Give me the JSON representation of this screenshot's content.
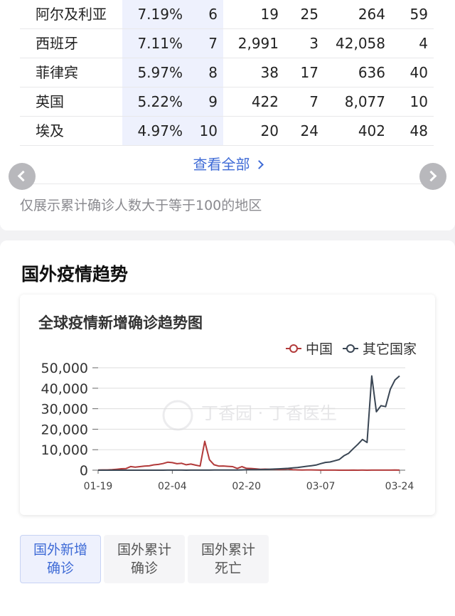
{
  "table": {
    "rows": [
      {
        "name": "阿尔及利亚",
        "pct": "7.19%",
        "rank": "6",
        "a": "19",
        "b": "25",
        "c": "264",
        "d": "59"
      },
      {
        "name": "西班牙",
        "pct": "7.11%",
        "rank": "7",
        "a": "2,991",
        "b": "3",
        "c": "42,058",
        "d": "4"
      },
      {
        "name": "菲律宾",
        "pct": "5.97%",
        "rank": "8",
        "a": "38",
        "b": "17",
        "c": "636",
        "d": "40"
      },
      {
        "name": "英国",
        "pct": "5.22%",
        "rank": "9",
        "a": "422",
        "b": "7",
        "c": "8,077",
        "d": "10"
      },
      {
        "name": "埃及",
        "pct": "4.97%",
        "rank": "10",
        "a": "20",
        "b": "24",
        "c": "402",
        "d": "48"
      }
    ],
    "see_all": "查看全部",
    "note": "仅展示累计确诊人数大于等于100的地区"
  },
  "trend": {
    "section_title": "国外疫情趋势",
    "watermark": "丁香园 · 丁香医生",
    "tabs": [
      {
        "label": "国外新增确诊",
        "active": true
      },
      {
        "label": "国外累计确诊",
        "active": false
      },
      {
        "label": "国外累计死亡",
        "active": false
      }
    ]
  },
  "chart_data": {
    "type": "line",
    "title": "全球疫情新增确诊趋势图",
    "xlabel": "",
    "ylabel": "",
    "ylim": [
      0,
      50000
    ],
    "yticks": [
      "50,000",
      "40,000",
      "30,000",
      "20,000",
      "10,000",
      "0"
    ],
    "xticks": [
      "01-19",
      "02-04",
      "02-20",
      "03-07",
      "03-24"
    ],
    "x": [
      "01-19",
      "01-20",
      "01-21",
      "01-22",
      "01-23",
      "01-24",
      "01-25",
      "01-26",
      "01-27",
      "01-28",
      "01-29",
      "01-30",
      "01-31",
      "02-01",
      "02-02",
      "02-03",
      "02-04",
      "02-05",
      "02-06",
      "02-07",
      "02-08",
      "02-09",
      "02-10",
      "02-11",
      "02-12",
      "02-13",
      "02-14",
      "02-15",
      "02-16",
      "02-17",
      "02-18",
      "02-19",
      "02-20",
      "02-21",
      "02-22",
      "02-23",
      "02-24",
      "02-25",
      "02-26",
      "02-27",
      "02-28",
      "02-29",
      "03-01",
      "03-02",
      "03-03",
      "03-04",
      "03-05",
      "03-06",
      "03-07",
      "03-08",
      "03-09",
      "03-10",
      "03-11",
      "03-12",
      "03-13",
      "03-14",
      "03-15",
      "03-16",
      "03-17",
      "03-18",
      "03-19",
      "03-20",
      "03-21",
      "03-22",
      "03-23",
      "03-24"
    ],
    "series": [
      {
        "name": "中国",
        "color": "#b23a3a",
        "values": [
          77,
          149,
          131,
          259,
          444,
          688,
          769,
          1771,
          1459,
          1737,
          1982,
          2102,
          2590,
          2829,
          3235,
          3887,
          3694,
          3143,
          3385,
          2652,
          2973,
          2467,
          2015,
          14108,
          5090,
          2641,
          2009,
          2048,
          1886,
          1749,
          820,
          1749,
          891,
          826,
          648,
          409,
          508,
          406,
          433,
          327,
          427,
          573,
          202,
          125,
          119,
          139,
          143,
          99,
          44,
          40,
          19,
          24,
          15,
          8,
          11,
          20,
          16,
          21,
          13,
          34,
          39,
          41,
          46,
          39,
          78,
          47
        ]
      },
      {
        "name": "其它国家",
        "color": "#3a4654",
        "values": [
          0,
          0,
          0,
          0,
          1,
          2,
          3,
          3,
          5,
          2,
          5,
          8,
          10,
          10,
          15,
          20,
          25,
          22,
          18,
          15,
          20,
          25,
          30,
          40,
          45,
          55,
          60,
          70,
          80,
          90,
          110,
          150,
          200,
          230,
          250,
          300,
          350,
          450,
          550,
          650,
          750,
          900,
          1100,
          1300,
          1600,
          1900,
          2200,
          2500,
          3200,
          3800,
          4000,
          4600,
          5200,
          7000,
          8200,
          10500,
          12600,
          15000,
          13500,
          46000,
          28500,
          31500,
          31000,
          39500,
          44000,
          46000
        ]
      }
    ],
    "legend_position": "top-right",
    "grid": true
  }
}
